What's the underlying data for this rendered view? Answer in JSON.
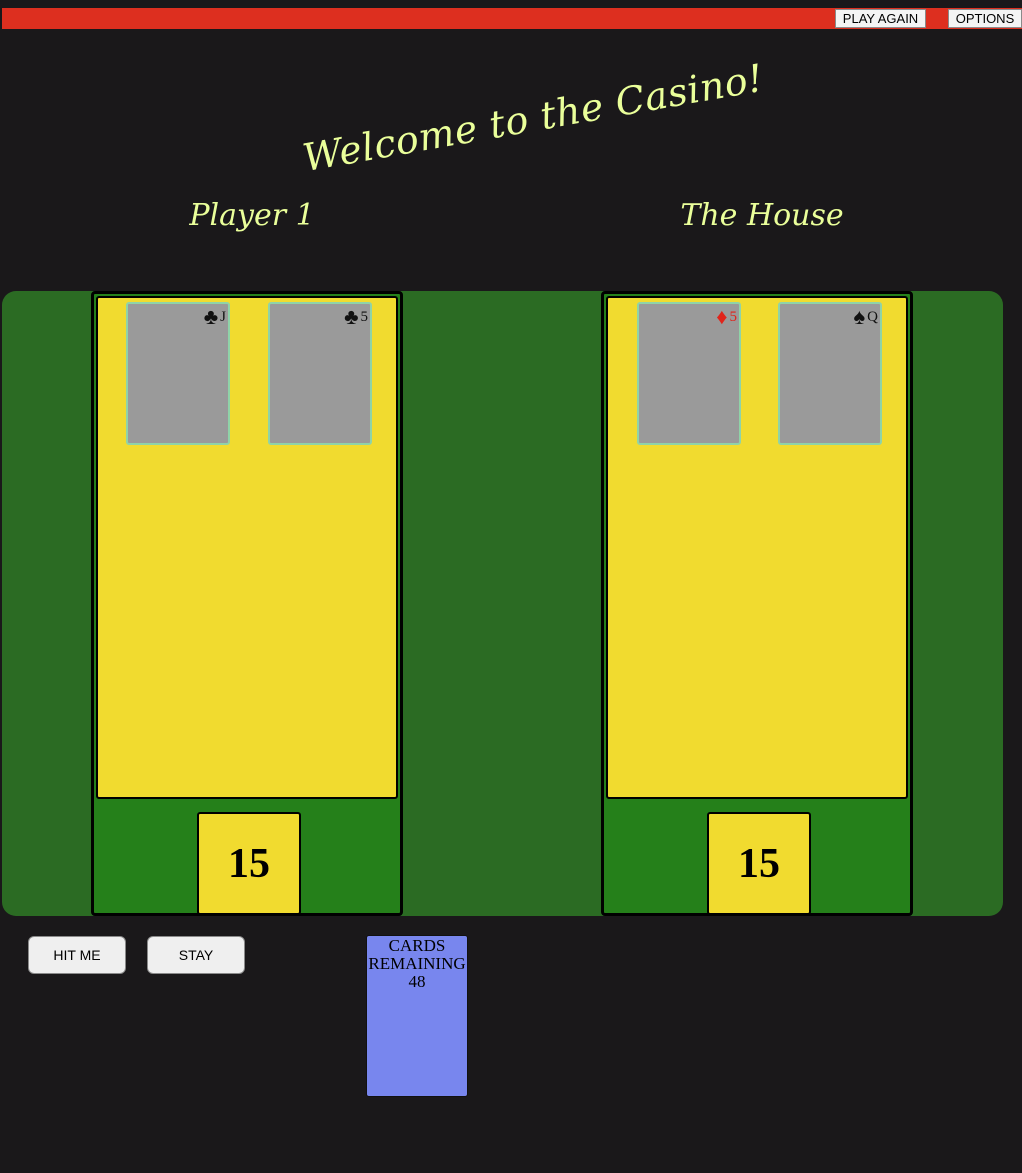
{
  "topbar": {
    "play_again": "PLAY AGAIN",
    "options": "OPTIONS"
  },
  "welcome": "Welcome to the Casino!",
  "player": {
    "title": "Player 1",
    "cards": [
      {
        "rank": "J",
        "suit": "♣"
      },
      {
        "rank": "5",
        "suit": "♣"
      }
    ],
    "score": "15"
  },
  "house": {
    "title": "The House",
    "cards": [
      {
        "rank": "5",
        "suit": "♦"
      },
      {
        "rank": "Q",
        "suit": "♠"
      }
    ],
    "score": "15"
  },
  "actions": {
    "hit": "HIT ME",
    "stay": "STAY"
  },
  "deck": {
    "label_line1": "CARDS",
    "label_line2": "REMAINING",
    "count": "48"
  },
  "colors": {
    "topbar": "#dd2f1f",
    "table": "#2b6b23",
    "seat": "#25801a",
    "hand": "#f1db2f",
    "card": "#9a9a9a",
    "deck": "#7886ee",
    "title_text": "#eaff9a",
    "diamond_red": "#e0241b"
  },
  "icons": {
    "clubs": "clubs-icon",
    "diamonds": "diamonds-icon",
    "spades": "spades-icon"
  }
}
